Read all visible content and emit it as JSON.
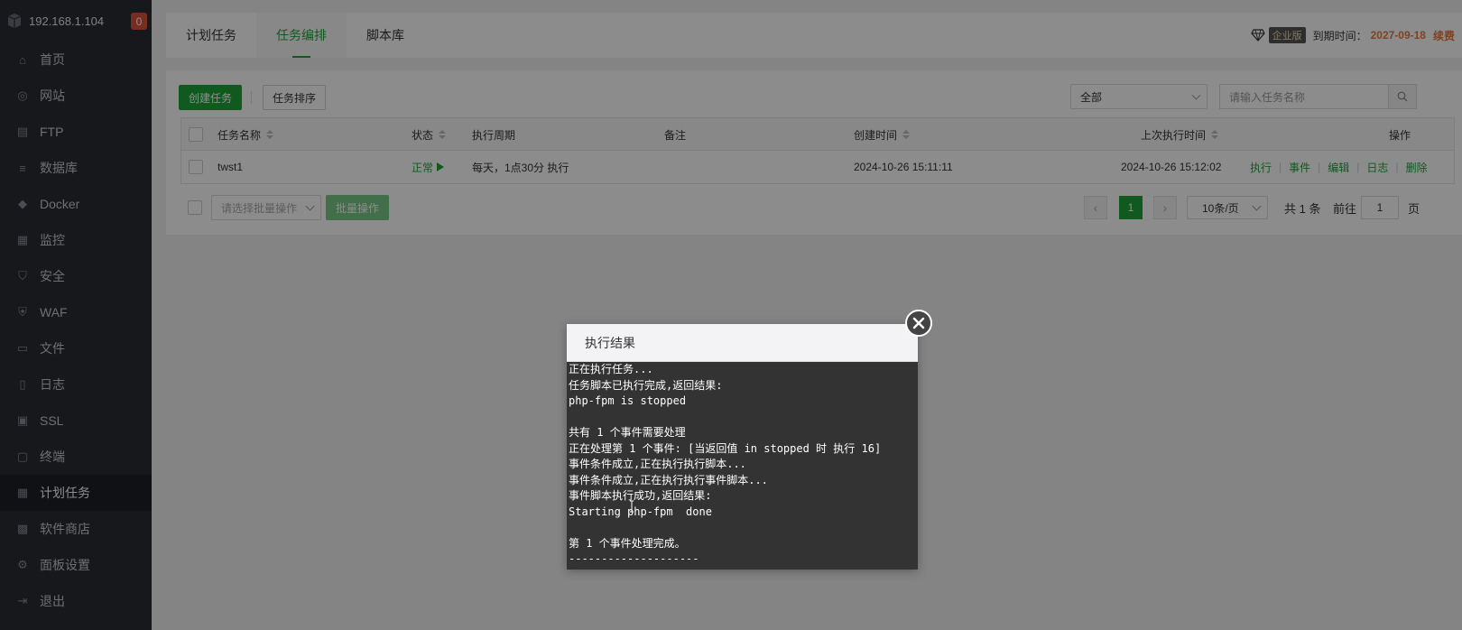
{
  "sidebar": {
    "server_ip": "192.168.1.104",
    "badge_count": "0",
    "items": [
      {
        "label": "首页",
        "icon": "home-icon",
        "glyph": "⌂"
      },
      {
        "label": "网站",
        "icon": "globe-icon",
        "glyph": "◎"
      },
      {
        "label": "FTP",
        "icon": "ftp-icon",
        "glyph": "▤"
      },
      {
        "label": "数据库",
        "icon": "database-icon",
        "glyph": "≡"
      },
      {
        "label": "Docker",
        "icon": "docker-icon",
        "glyph": "◆"
      },
      {
        "label": "监控",
        "icon": "monitor-icon",
        "glyph": "▦"
      },
      {
        "label": "安全",
        "icon": "shield-icon",
        "glyph": "⛉"
      },
      {
        "label": "WAF",
        "icon": "waf-icon",
        "glyph": "⛨"
      },
      {
        "label": "文件",
        "icon": "folder-icon",
        "glyph": "▭"
      },
      {
        "label": "日志",
        "icon": "log-icon",
        "glyph": "▯"
      },
      {
        "label": "SSL",
        "icon": "ssl-icon",
        "glyph": "▣"
      },
      {
        "label": "终端",
        "icon": "terminal-icon",
        "glyph": "▢"
      },
      {
        "label": "计划任务",
        "icon": "calendar-icon",
        "glyph": "▦"
      },
      {
        "label": "软件商店",
        "icon": "store-icon",
        "glyph": "▩"
      },
      {
        "label": "面板设置",
        "icon": "gear-icon",
        "glyph": "⚙"
      },
      {
        "label": "退出",
        "icon": "logout-icon",
        "glyph": "⇥"
      }
    ],
    "active_index": 12
  },
  "topbar": {
    "tabs": [
      "计划任务",
      "任务编排",
      "脚本库"
    ],
    "active_tab": 1,
    "edition": "企业版",
    "expire_label": "到期时间：",
    "expire_date": "2027-09-18",
    "renew": "续费"
  },
  "toolbar": {
    "create_label": "创建任务",
    "sort_label": "任务排序",
    "filter_value": "全部",
    "search_placeholder": "请输入任务名称"
  },
  "table": {
    "headers": {
      "name": "任务名称",
      "status": "状态",
      "cycle": "执行周期",
      "remark": "备注",
      "created": "创建时间",
      "last_run": "上次执行时间",
      "ops": "操作"
    },
    "rows": [
      {
        "name": "twst1",
        "status": "正常",
        "cycle": "每天，1点30分 执行",
        "remark": "",
        "created": "2024-10-26 15:11:11",
        "last_run": "2024-10-26 15:12:02",
        "ops": [
          "执行",
          "事件",
          "编辑",
          "日志",
          "删除"
        ]
      }
    ]
  },
  "footer": {
    "batch_placeholder": "请选择批量操作",
    "batch_button": "批量操作",
    "page_current": "1",
    "page_size": "10条/页",
    "total": "共 1 条",
    "goto_label": "前往",
    "goto_value": "1",
    "page_unit": "页"
  },
  "modal": {
    "title": "执行结果",
    "output": "正在执行任务...\n任务脚本已执行完成,返回结果:\nphp-fpm is stopped\n\n共有 1 个事件需要处理\n正在处理第 1 个事件: [当返回值 in stopped 时 执行 16]\n事件条件成立,正在执行执行脚本...\n事件条件成立,正在执行执行事件脚本...\n事件脚本执行成功,返回结果:\nStarting php-fpm  done\n\n第 1 个事件处理完成。\n--------------------"
  }
}
